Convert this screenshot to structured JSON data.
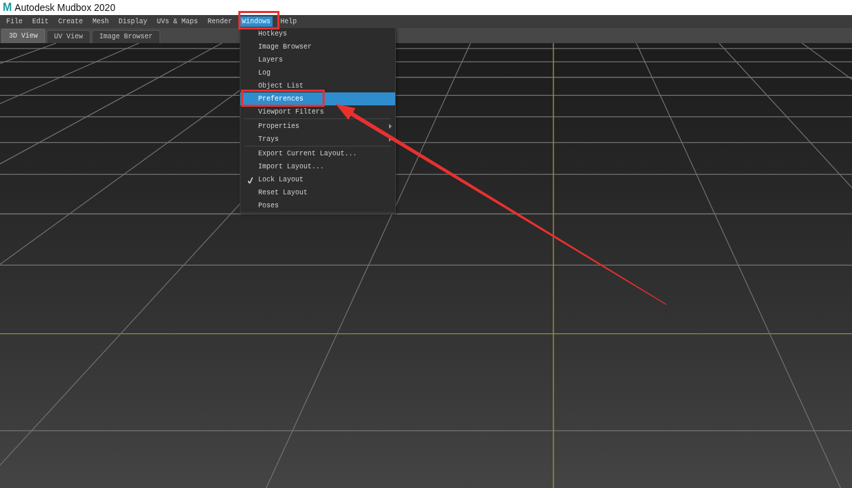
{
  "window": {
    "logo": "M",
    "title": "Autodesk Mudbox 2020"
  },
  "menu_bar": [
    {
      "label": "File",
      "selected": false,
      "annotated": false
    },
    {
      "label": "Edit",
      "selected": false,
      "annotated": false
    },
    {
      "label": "Create",
      "selected": false,
      "annotated": false
    },
    {
      "label": "Mesh",
      "selected": false,
      "annotated": false
    },
    {
      "label": "Display",
      "selected": false,
      "annotated": false
    },
    {
      "label": "UVs & Maps",
      "selected": false,
      "annotated": false
    },
    {
      "label": "Render",
      "selected": false,
      "annotated": false
    },
    {
      "label": "Windows",
      "selected": true,
      "annotated": true
    },
    {
      "label": "Help",
      "selected": false,
      "annotated": false
    }
  ],
  "tabs": [
    {
      "label": "3D View",
      "selected": true
    },
    {
      "label": "UV View",
      "selected": false
    },
    {
      "label": "Image Browser",
      "selected": false
    }
  ],
  "dropdown_menu": {
    "sections": [
      {
        "items": [
          {
            "label": "Hotkeys",
            "kind": "command",
            "selected": false,
            "annotated": false
          },
          {
            "label": "Image Browser",
            "kind": "command",
            "selected": false,
            "annotated": false
          },
          {
            "label": "Layers",
            "kind": "command",
            "selected": false,
            "annotated": false
          },
          {
            "label": "Log",
            "kind": "command",
            "selected": false,
            "annotated": false
          },
          {
            "label": "Object List",
            "kind": "command",
            "selected": false,
            "annotated": false
          },
          {
            "label": "Preferences",
            "kind": "command",
            "selected": true,
            "annotated": true
          },
          {
            "label": "Viewport Filters",
            "kind": "command",
            "selected": false,
            "annotated": false
          }
        ]
      },
      {
        "items": [
          {
            "label": "Properties",
            "kind": "submenu",
            "selected": false,
            "annotated": false
          },
          {
            "label": "Trays",
            "kind": "submenu",
            "selected": false,
            "annotated": false
          }
        ]
      },
      {
        "items": [
          {
            "label": "Export Current Layout...",
            "kind": "command",
            "selected": false,
            "annotated": false
          },
          {
            "label": "Import Layout...",
            "kind": "command",
            "selected": false,
            "annotated": false
          },
          {
            "label": "Lock Layout",
            "kind": "toggle",
            "checked": true,
            "selected": false,
            "annotated": false
          },
          {
            "label": "Reset Layout",
            "kind": "command",
            "selected": false,
            "annotated": false
          },
          {
            "label": "Poses",
            "kind": "command",
            "selected": false,
            "annotated": false
          }
        ]
      }
    ]
  },
  "annotation": {
    "arrow": true
  }
}
